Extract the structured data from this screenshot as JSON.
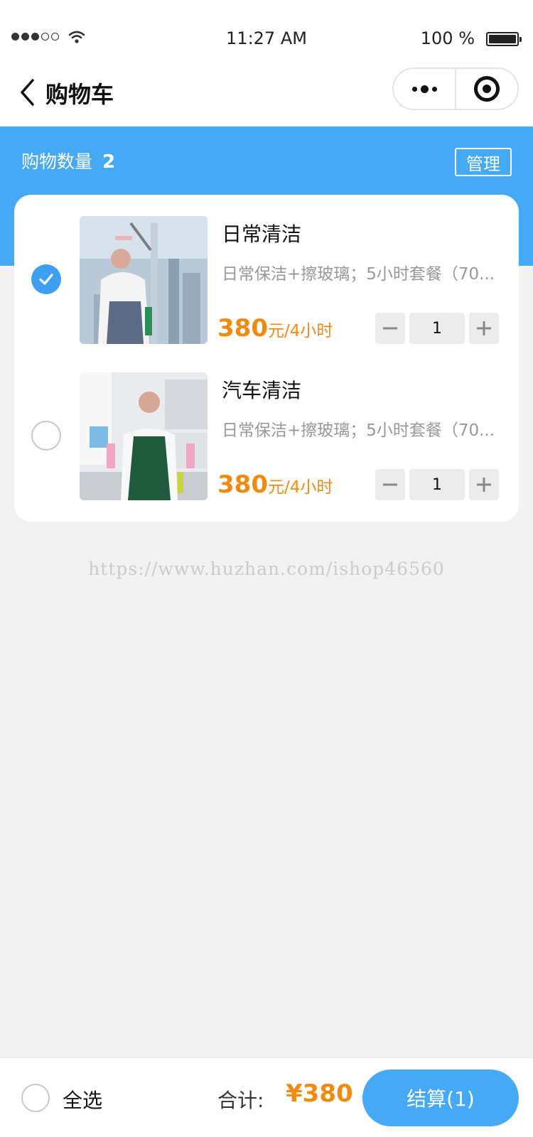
{
  "status_bar": {
    "time": "11:27 AM",
    "battery": "100 %"
  },
  "nav": {
    "title": "购物车"
  },
  "summary": {
    "label": "购物数量",
    "count": "2",
    "manage_label": "管理"
  },
  "items": [
    {
      "title": "日常清洁",
      "desc": "日常保洁+擦玻璃；5小时套餐（70...",
      "price": "380",
      "unit": "元/4小时",
      "qty": "1",
      "selected": true,
      "image": "window-cleaning-photo"
    },
    {
      "title": "汽车清洁",
      "desc": "日常保洁+擦玻璃；5小时套餐（70...",
      "price": "380",
      "unit": "元/4小时",
      "qty": "1",
      "selected": false,
      "image": "kitchen-cleaning-photo"
    }
  ],
  "watermark": "https://www.huzhan.com/ishop46560",
  "footer": {
    "select_all_label": "全选",
    "total_label": "合计:",
    "total_value": "¥380",
    "checkout_label": "结算(1)"
  },
  "colors": {
    "accent": "#46a9f5",
    "price": "#f28a12"
  }
}
